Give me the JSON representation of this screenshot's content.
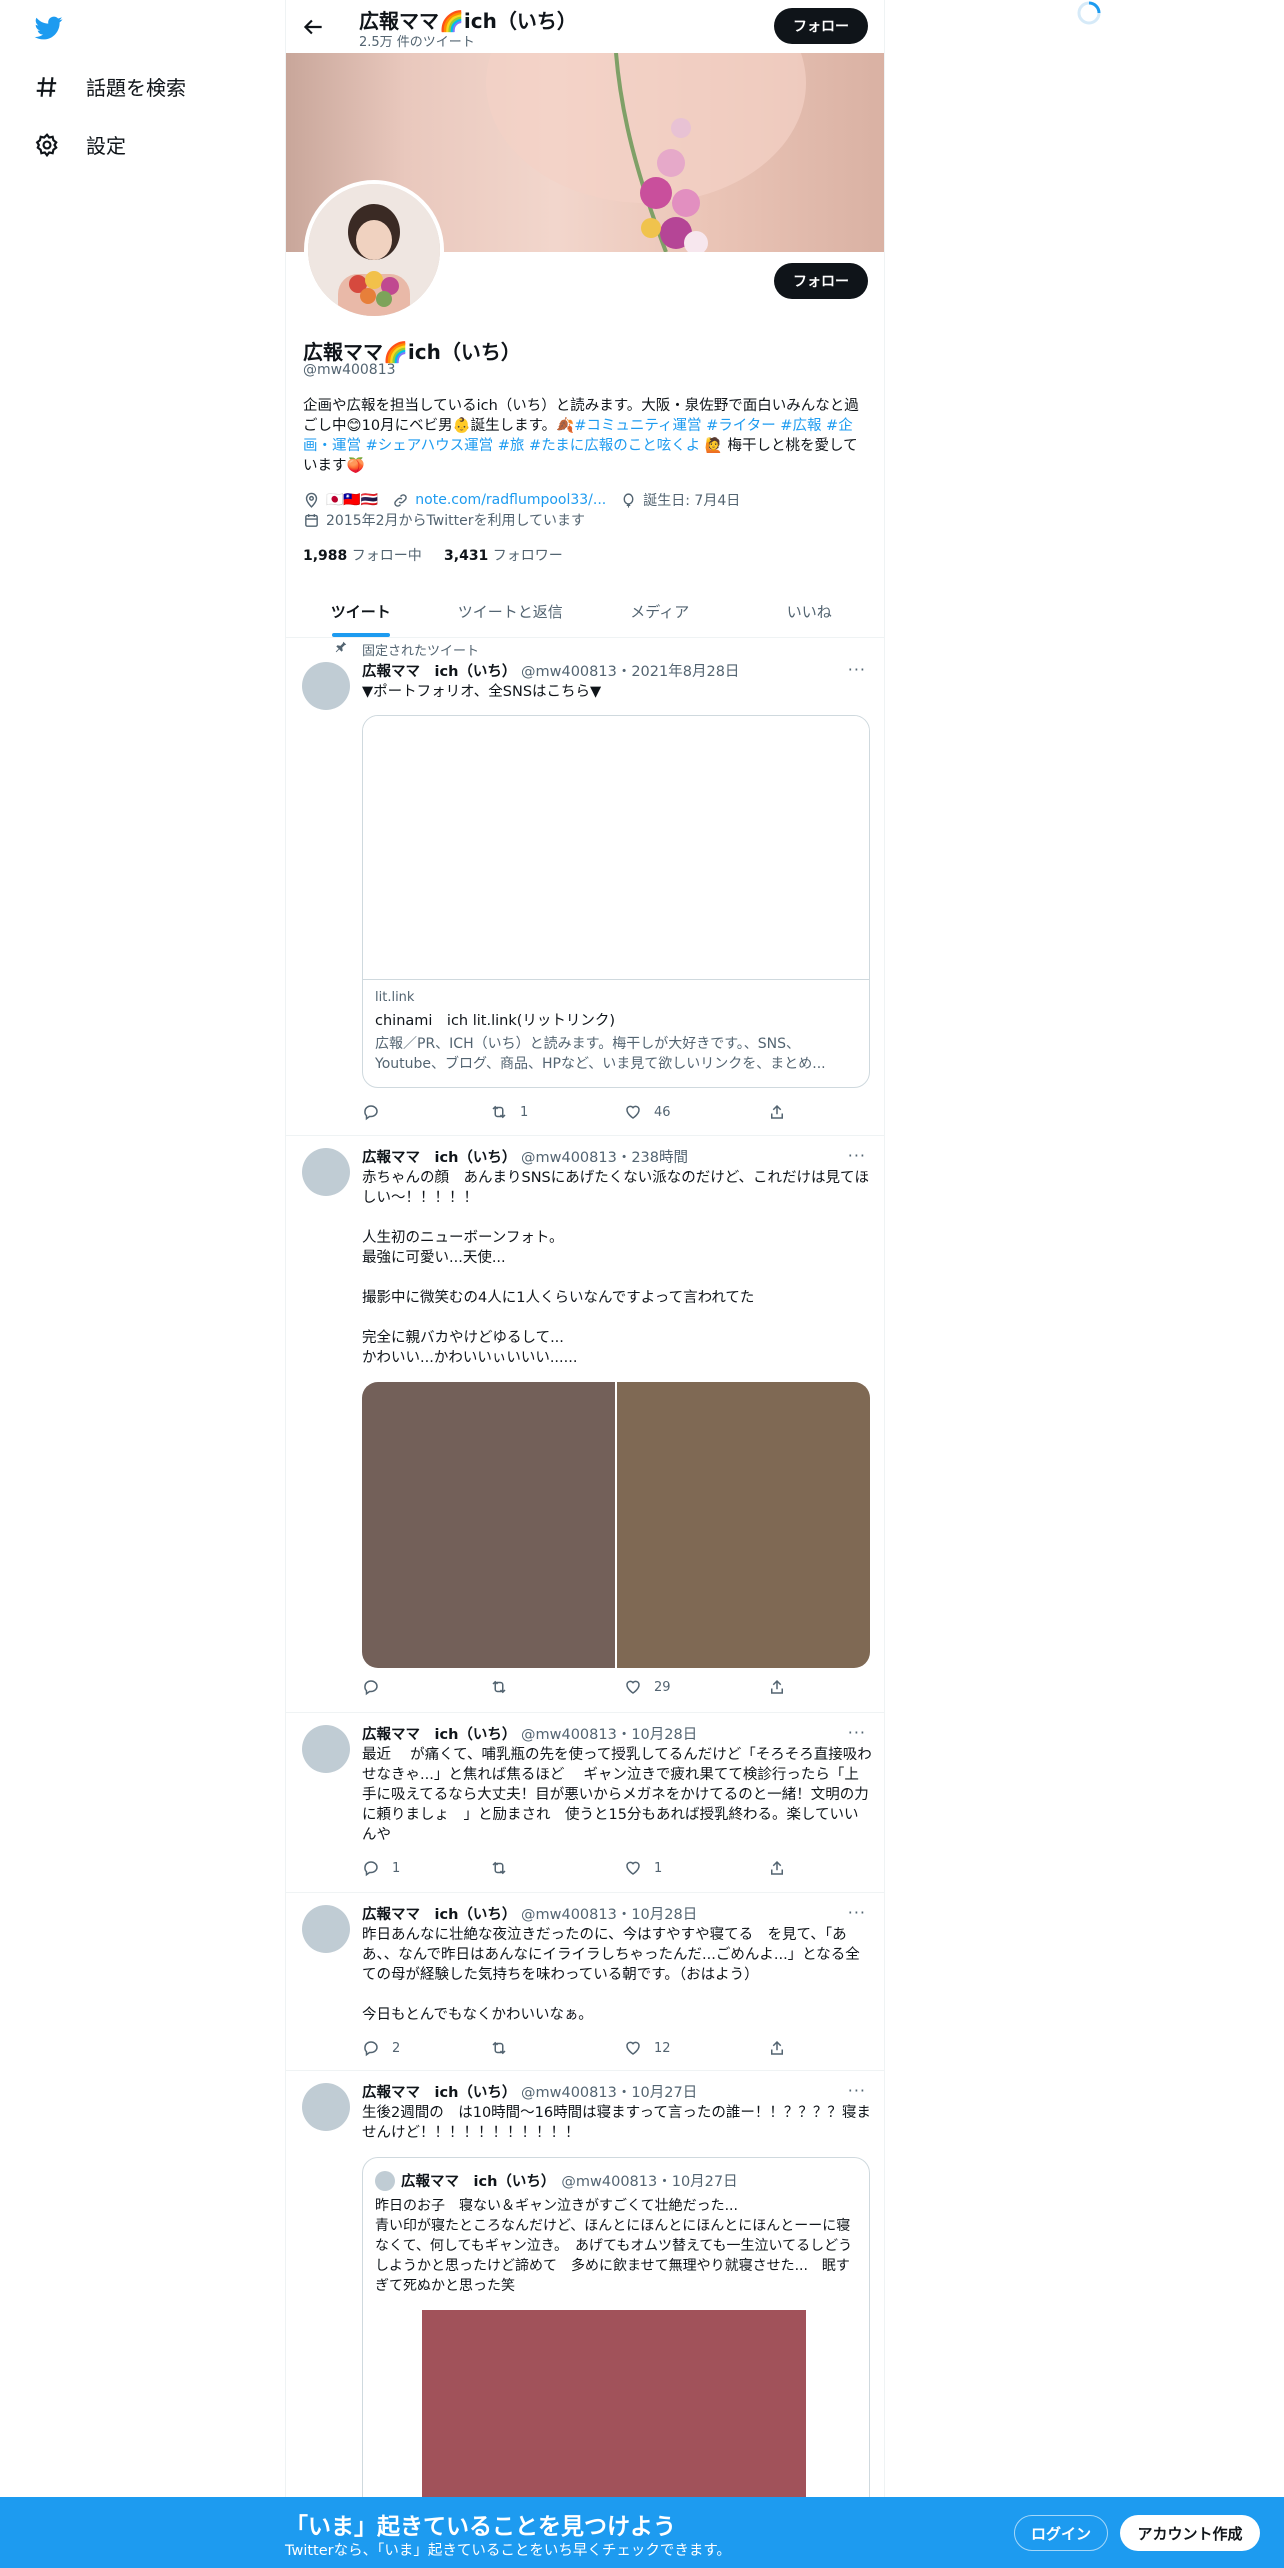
{
  "nav": {
    "items": [
      {
        "label": "話題を検索",
        "icon": "hashtag-icon"
      },
      {
        "label": "設定",
        "icon": "gear-icon"
      }
    ]
  },
  "topbar": {
    "title": "広報ママ🌈ich（いち）",
    "tweet_count": "2.5万 件のツイート",
    "follow_label": "フォロー"
  },
  "profile": {
    "name": "広報ママ🌈ich（いち）",
    "handle": "@mw400813",
    "follow_label": "フォロー",
    "bio_pre": "企画や広報を担当しているich（いち）と読みます。大阪・泉佐野で面白いみんなと過ごし中😊10月にベビ男👶誕生します。🍂",
    "bio_tags1": "#コミュニティ運営 #ライター #広報 #企画・運営 #シェアハウス運営 #旅 #たまに広報のこと呟くよ",
    "bio_post": " 🙋 梅干しと桃を愛しています🍑",
    "location": "🇯🇵🇹🇼🇹🇭",
    "link": "note.com/radflumpool33/...",
    "birthday": "誕生日: 7月4日",
    "joined": "2015年2月からTwitterを利用しています",
    "following_count": "1,988",
    "following_label": "フォロー中",
    "followers_count": "3,431",
    "followers_label": "フォロワー"
  },
  "tabs": [
    "ツイート",
    "ツイートと返信",
    "メディア",
    "いいね"
  ],
  "pinned_label": "固定されたツイート",
  "tweets": [
    {
      "name": "広報ママ　ich（いち）",
      "meta": "@mw400813・2021年8月28日",
      "text": "▼ポートフォリオ、全SNSはこちら▼",
      "card": {
        "domain": "lit.link",
        "title": "chinami　ich lit.link(リットリンク)",
        "desc": "広報／PR、ICH（いち）と読みます。梅干しが大好きです。、SNS、Youtube、ブログ、商品、HPなど、いま見て欲しいリンクを、まとめ..."
      },
      "reply": "",
      "retweet": "1",
      "like": "46"
    },
    {
      "name": "広報ママ　ich（いち）",
      "meta": "@mw400813・238時間",
      "text": "赤ちゃんの顔　あんまりSNSにあげたくない派なのだけど、これだけは見てほしい〜！！！！！\n\n人生初のニューボーンフォト。\n最強に可愛い...天使...\n\n撮影中に微笑むの4人に1人くらいなんですよって言われてた\n\n完全に親バカやけどゆるして...\nかわいい...かわいいぃいいい......",
      "media_colors": [
        "#736059",
        "#7f6954"
      ],
      "reply": "",
      "retweet": "",
      "like": "29"
    },
    {
      "name": "広報ママ　ich（いち）",
      "meta": "@mw400813・10月28日",
      "text": "最近　 が痛くて、哺乳瓶の先を使って授乳してるんだけど「そろそろ直接吸わせなきゃ...」と焦れば焦るほど　 ギャン泣きで疲れ果てて検診行ったら「上手に吸えてるなら大丈夫！目が悪いからメガネをかけてるのと一緒！文明の力に頼りましょ　」と励まされ　使うと15分もあれば授乳終わる。楽していいんや",
      "reply": "1",
      "retweet": "",
      "like": "1"
    },
    {
      "name": "広報ママ　ich（いち）",
      "meta": "@mw400813・10月28日",
      "text": "昨日あんなに壮絶な夜泣きだったのに、今はすやすや寝てる　を見て、「ああ、、なんで昨日はあんなにイライラしちゃったんだ...ごめんよ...」となる全ての母が経験した気持ちを味わっている朝です。（おはよう）\n\n今日もとんでもなくかわいいなぁ。",
      "reply": "2",
      "retweet": "",
      "like": "12"
    },
    {
      "name": "広報ママ　ich（いち）",
      "meta": "@mw400813・10月27日",
      "text": "生後2週間の　は10時間〜16時間は寝ますって言ったの誰ー！！？？？？寝ませんけど！！！！！！！！！！！",
      "quote": {
        "name": "広報ママ　ich（いち）",
        "meta": "@mw400813・10月27日",
        "text": "昨日のお子　寝ない＆ギャン泣きがすごくて壮絶だった...\n青い印が寝たところなんだけど、ほんとにほんとにほんとにほんとーーに寝なくて、何してもギャン泣き。　あげてもオムツ替えても一生泣いてるしどうしようかと思ったけど諦めて　多めに飲ませて無理やり就寝させた...　眠すぎて死ぬかと思った笑",
        "img_color": "#a1525a"
      }
    }
  ],
  "bottom": {
    "title": "「いま」起きていることを見つけよう",
    "subtitle": "Twitterなら、「いま」起きていることをいち早くチェックできます。",
    "login": "ログイン",
    "signup": "アカウント作成"
  },
  "colors": {
    "accent": "#1d9bf0",
    "dark": "#0f1419",
    "muted": "#536471"
  }
}
